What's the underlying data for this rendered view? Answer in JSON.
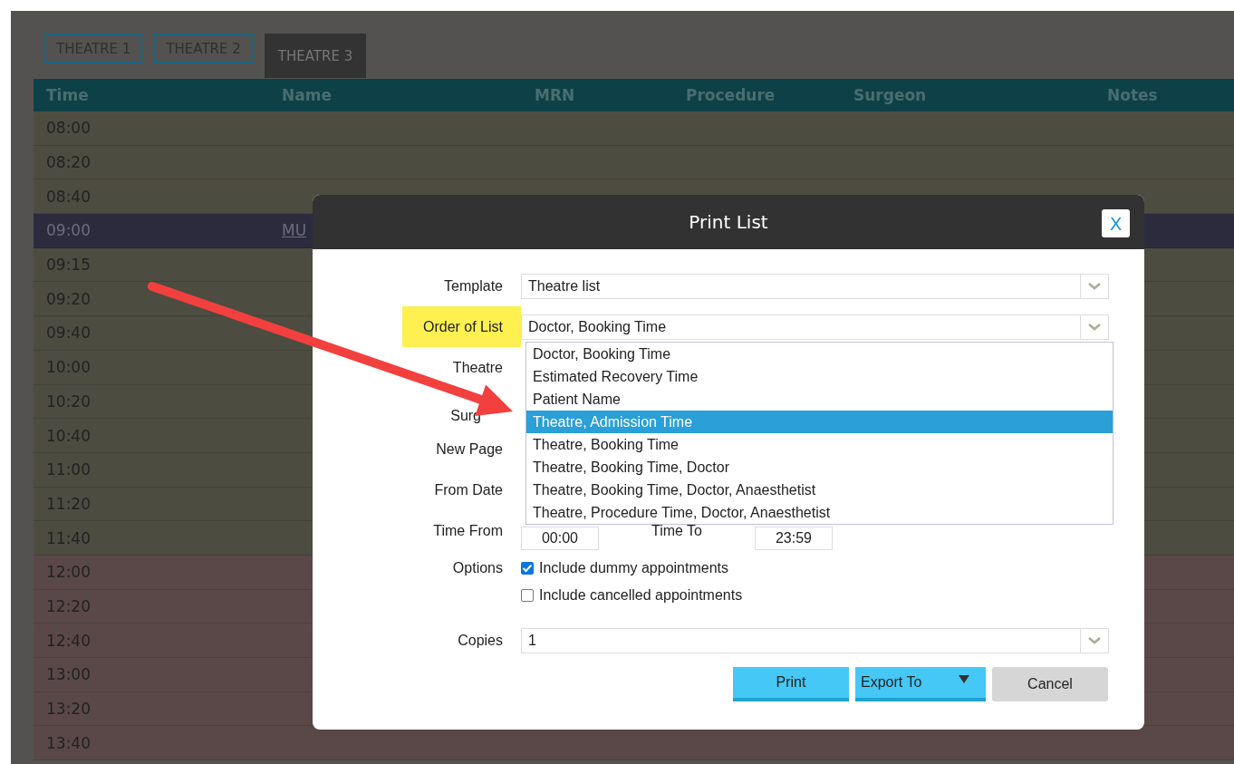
{
  "tabs": [
    {
      "label": "THEATRE 1",
      "selected": false
    },
    {
      "label": "THEATRE 2",
      "selected": false
    },
    {
      "label": "THEATRE 3",
      "selected": true
    }
  ],
  "table": {
    "columns": [
      "Time",
      "Name",
      "MRN",
      "Procedure",
      "Surgeon",
      "Notes"
    ],
    "rows": [
      {
        "time": "08:00",
        "color": "#4d4c40",
        "selected": false
      },
      {
        "time": "08:20",
        "color": "#4d4c40",
        "selected": false
      },
      {
        "time": "08:40",
        "color": "#4d4c40",
        "selected": false
      },
      {
        "time": "09:00",
        "name": "MU",
        "color": "#2c2b3e",
        "selected": true
      },
      {
        "time": "09:15",
        "color": "#4d4c40",
        "selected": false
      },
      {
        "time": "09:20",
        "color": "#4d4c40",
        "selected": false
      },
      {
        "time": "09:40",
        "color": "#4d4c40",
        "selected": false
      },
      {
        "time": "10:00",
        "color": "#4d4c40",
        "selected": false
      },
      {
        "time": "10:20",
        "color": "#4d4c40",
        "selected": false
      },
      {
        "time": "10:40",
        "color": "#4d4c40",
        "selected": false
      },
      {
        "time": "11:00",
        "color": "#4d4c40",
        "selected": false
      },
      {
        "time": "11:20",
        "color": "#4d4c40",
        "selected": false
      },
      {
        "time": "11:40",
        "color": "#4d4c40",
        "selected": false
      },
      {
        "time": "12:00",
        "color": "#5a4848",
        "selected": false
      },
      {
        "time": "12:20",
        "color": "#5a4848",
        "selected": false
      },
      {
        "time": "12:40",
        "color": "#5a4848",
        "selected": false
      },
      {
        "time": "13:00",
        "color": "#5a4848",
        "selected": false
      },
      {
        "time": "13:20",
        "color": "#5a4848",
        "selected": false
      },
      {
        "time": "13:40",
        "color": "#5a4848",
        "selected": false
      }
    ]
  },
  "dialog": {
    "title": "Print List",
    "close": "X",
    "template": {
      "label": "Template",
      "value": "Theatre list"
    },
    "order": {
      "label": "Order of List",
      "highlighted": true,
      "value": "Doctor, Booking Time"
    },
    "labels": [
      "Theatre",
      "Surg",
      "New Page",
      "From Date"
    ],
    "time_from": {
      "label": "Time From",
      "value": "00:00"
    },
    "time_to": {
      "label": "Time To",
      "value": "23:59"
    },
    "options_label": "Options",
    "options": [
      {
        "label": "Include dummy appointments",
        "checked": true
      },
      {
        "label": "Include cancelled appointments",
        "checked": false
      }
    ],
    "copies": {
      "label": "Copies",
      "value": "1"
    },
    "buttons": [
      {
        "label": "Print",
        "kind": "primary"
      },
      {
        "label": "Export To",
        "kind": "menu"
      },
      {
        "label": "Cancel",
        "kind": "secondary"
      }
    ],
    "order_options": [
      {
        "label": "Doctor, Booking Time",
        "selected": false
      },
      {
        "label": "Estimated Recovery Time",
        "selected": false
      },
      {
        "label": "Patient Name",
        "selected": false
      },
      {
        "label": "Theatre, Admission Time",
        "selected": true
      },
      {
        "label": "Theatre, Booking Time",
        "selected": false
      },
      {
        "label": "Theatre, Booking Time, Doctor",
        "selected": false
      },
      {
        "label": "Theatre, Booking Time, Doctor, Anaesthetist",
        "selected": false
      },
      {
        "label": "Theatre, Procedure Time, Doctor, Anaesthetist",
        "selected": false
      }
    ]
  }
}
